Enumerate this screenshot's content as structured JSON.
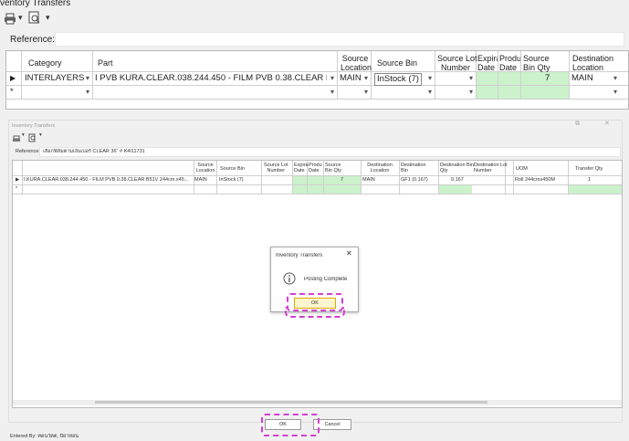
{
  "top_window": {
    "title": "ventory Transfers",
    "reference_label": "Reference:",
    "reference_value": "",
    "toolbar": {
      "print_icon": "printer-icon",
      "preview_icon": "preview-icon",
      "dropdown_glyph": "▾"
    },
    "grid": {
      "columns": [
        "Category",
        "Part",
        "Source Location",
        "Source Bin",
        "Source Lot Number",
        "Expiration Date",
        "Production Date",
        "Source Bin Qty",
        "Destination Location"
      ],
      "column_display": [
        "Category",
        "Part",
        "Source\nLocation",
        "Source Bin",
        "Source Lot\nNumber",
        "Expirat\nDate",
        "Produ\nDate",
        "Source\nBin Qty",
        "Destination\nLocation"
      ],
      "rows": [
        {
          "indicator": "▶",
          "category": "INTERLAYERS",
          "part": "I PVB KURA.CLEAR.038.244.450 - FILM PVB 0.38.CLEAR B51V 244cm.x45...",
          "source_location": "MAIN",
          "source_bin": "InStock (7)",
          "source_lot": "",
          "expiration": "",
          "production": "",
          "source_bin_qty": "7",
          "destination_location": "MAIN"
        },
        {
          "indicator": "*",
          "category": "",
          "part": "",
          "source_location": "",
          "source_bin": "",
          "source_lot": "",
          "expiration": "",
          "production": "",
          "source_bin_qty": "",
          "destination_location": ""
        }
      ]
    }
  },
  "inner_window": {
    "title": "Inventory Transfers",
    "window_controls": {
      "restore": "⧉",
      "close": "✕"
    },
    "reference_label": "Reference:",
    "reference_value": "เลือกฟิล์มตามเงินเบอร์ CLEAR 36\" # K4I11731",
    "grid": {
      "headers": [
        "",
        "Source Location",
        "Source Bin",
        "Source Lot Number",
        "Expiration Date",
        "Production Date",
        "Source Bin Qty",
        "Destination Location",
        "Destination Bin",
        "Destination Bin Qty",
        "Destination Lot Number",
        "UOM",
        "Transfer Qty"
      ],
      "header_display": [
        "",
        "Source\nLocation",
        "Source Bin",
        "Source Lot\nNumber",
        "Expira\nDate",
        "Produ\nDate",
        "Source\nBin Qty",
        "Destination\nLocation",
        "Destination\nBin",
        "Destination Bin\nQty",
        "Destination Lot\nNumber",
        "UOM",
        "Transfer Qty"
      ],
      "row": {
        "indicator": "▶",
        "part": "I.KURA.CLEAR.038.244.450 - FILM PVB 0.38.CLEAR B51V 244cm.x45...",
        "source_location": "MAIN",
        "source_bin": "InStock (7)",
        "source_lot": "",
        "expiration": "",
        "production": "",
        "source_bin_qty": "7",
        "destination_location": "MAIN",
        "destination_bin": "GF1 (0.167)",
        "destination_bin_qty": "0.167",
        "destination_lot": "",
        "uom": "Roll 244cmx450M",
        "transfer_qty": "1"
      },
      "new_row_indicator": "*"
    },
    "ok_label": "OK",
    "cancel_label": "Cancel",
    "entered_by": "Entered By: ทดนวัตต, ปัยาทอน"
  },
  "dialog": {
    "title": "Inventory Transfers",
    "close_glyph": "✕",
    "info_icon": "info-icon",
    "message": "Posting Complete",
    "ok_label": "OK"
  },
  "colors": {
    "highlight_dash": "#d43fd4",
    "green_cell": "#ccf2cc",
    "button_accent": "#f7c948"
  }
}
